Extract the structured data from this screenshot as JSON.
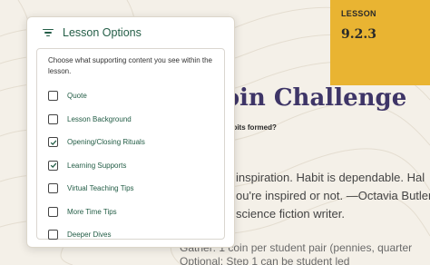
{
  "lesson": {
    "label": "LESSON",
    "number": "9.2.3"
  },
  "title": "Coin Challenge",
  "question": "abits formed?",
  "body_lines": [
    "inspiration. Habit is dependable. Hal",
    "ou're inspired or not. —Octavia Butler",
    "science fiction writer."
  ],
  "faded_lines": [
    "Gather: 1 coin per student pair (pennies, quarter",
    "Optional: Step 1 can be student led"
  ],
  "panel": {
    "title": "Lesson Options",
    "description": "Choose what supporting content you see within the lesson.",
    "options": [
      {
        "label": "Quote",
        "checked": false
      },
      {
        "label": "Lesson Background",
        "checked": false
      },
      {
        "label": "Opening/Closing Rituals",
        "checked": true
      },
      {
        "label": "Learning Supports",
        "checked": true
      },
      {
        "label": "Virtual Teaching Tips",
        "checked": false
      },
      {
        "label": "More Time Tips",
        "checked": false
      },
      {
        "label": "Deeper Dives",
        "checked": false
      }
    ]
  },
  "colors": {
    "accent": "#245e47",
    "badge": "#e9b432",
    "title": "#3e3567",
    "background": "#f4f0e8"
  },
  "icons": {
    "menu": "filter-icon",
    "check": "check-icon"
  }
}
